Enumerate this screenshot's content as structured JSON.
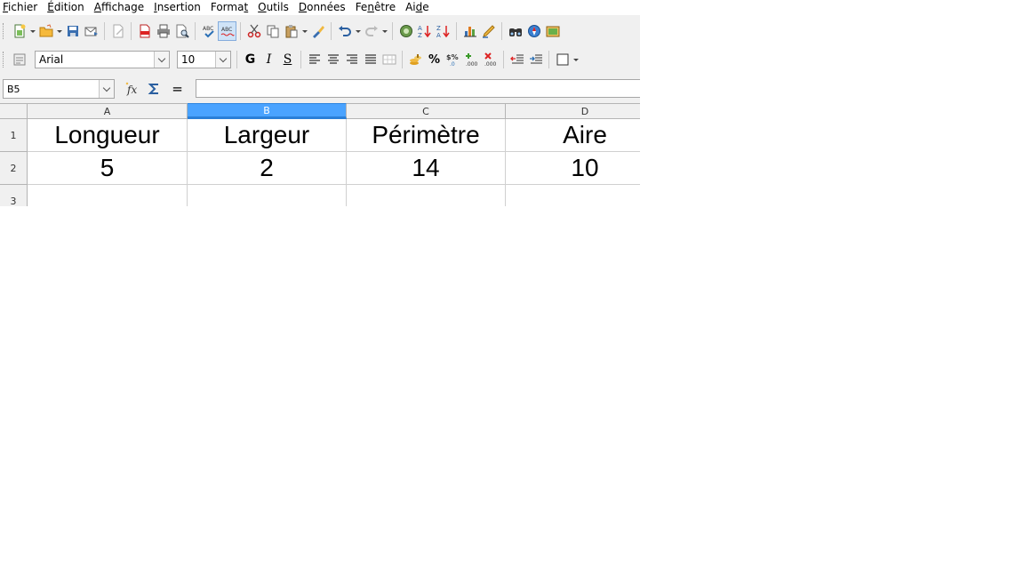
{
  "menu": [
    {
      "pre": "",
      "u": "F",
      "post": "ichier"
    },
    {
      "pre": "",
      "u": "É",
      "post": "dition"
    },
    {
      "pre": "",
      "u": "A",
      "post": "ffichage"
    },
    {
      "pre": "",
      "u": "I",
      "post": "nsertion"
    },
    {
      "pre": "Forma",
      "u": "t",
      "post": ""
    },
    {
      "pre": "",
      "u": "O",
      "post": "utils"
    },
    {
      "pre": "",
      "u": "D",
      "post": "onnées"
    },
    {
      "pre": "Fe",
      "u": "n",
      "post": "être"
    },
    {
      "pre": "Ai",
      "u": "d",
      "post": "e"
    }
  ],
  "format": {
    "font_name": "Arial",
    "font_size": "10",
    "bold_label": "G",
    "italic_label": "I",
    "underline_label": "S",
    "percent_label": "%"
  },
  "formula": {
    "cell_ref": "B5",
    "equals_label": "=",
    "content": ""
  },
  "sheet": {
    "columns": [
      "A",
      "B",
      "C",
      "D"
    ],
    "selected_column": "B",
    "rows": [
      "1",
      "2",
      "3"
    ],
    "cells": [
      [
        "Longueur",
        "Largeur",
        "Périmètre",
        "Aire"
      ],
      [
        "5",
        "2",
        "14",
        "10"
      ],
      [
        "",
        "",
        "",
        ""
      ]
    ]
  },
  "colors": {
    "selection_header": "#4aa3ff",
    "toolbar_bg": "#f0f0f0"
  }
}
